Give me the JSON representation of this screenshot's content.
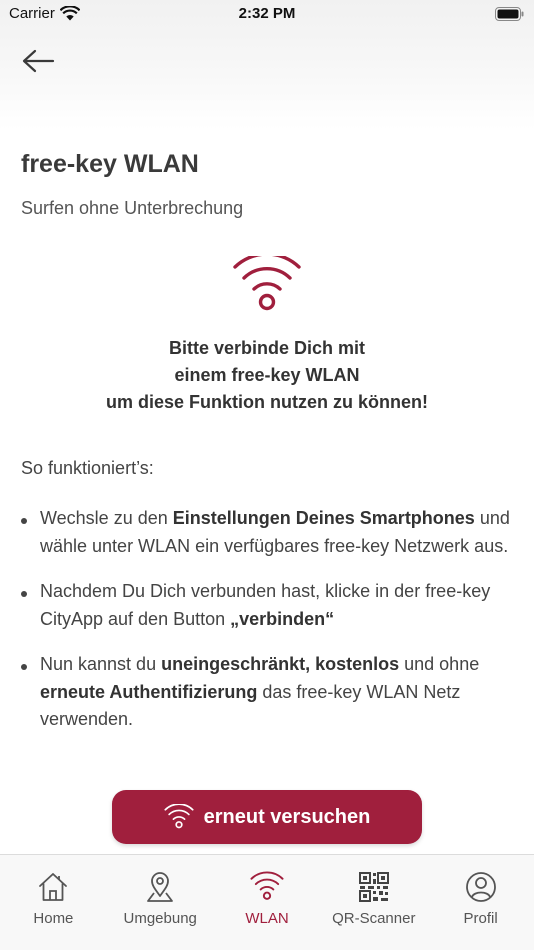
{
  "status_bar": {
    "carrier": "Carrier",
    "time": "2:32 PM",
    "icons": [
      "wifi-signal-icon",
      "battery-icon"
    ]
  },
  "header": {
    "back_icon": "arrow-left-icon"
  },
  "content": {
    "title": "free-key WLAN",
    "subtitle": "Surfen ohne Unterbrechung",
    "hero_icon": "wifi-icon",
    "notice_lines": [
      "Bitte verbinde Dich mit",
      "einem free-key WLAN",
      "um diese Funktion nutzen zu können!"
    ],
    "how_title": "So funktioniert’s:",
    "steps": [
      {
        "t1": "Wechsle zu den ",
        "b1": "Einstellungen Deines Smartphones",
        "t2": " und wähle unter WLAN ein verfügbares free-key Netzwerk aus."
      },
      {
        "t1": "Nachdem Du Dich verbunden hast, klicke in der free-key CityApp auf den Button ",
        "b1": "„verbinden“"
      },
      {
        "t1": "Nun kannst du ",
        "b1": "uneingeschränkt, kostenlos",
        "t2": " und ohne ",
        "b2": "erneute Authentifizierung",
        "t3": " das free-key WLAN Netz verwenden."
      }
    ],
    "retry_label": "erneut versuchen",
    "retry_icon": "wifi-icon"
  },
  "tab_bar": {
    "items": [
      {
        "label": "Home",
        "icon": "home-icon"
      },
      {
        "label": "Umgebung",
        "icon": "location-pin-icon"
      },
      {
        "label": "WLAN",
        "icon": "wifi-icon",
        "active": true
      },
      {
        "label": "QR-Scanner",
        "icon": "qr-code-icon"
      },
      {
        "label": "Profil",
        "icon": "user-icon"
      }
    ]
  },
  "colors": {
    "accent": "#a01f3d",
    "text": "#333333",
    "tab_bar_bg": "#f8f8f8"
  }
}
